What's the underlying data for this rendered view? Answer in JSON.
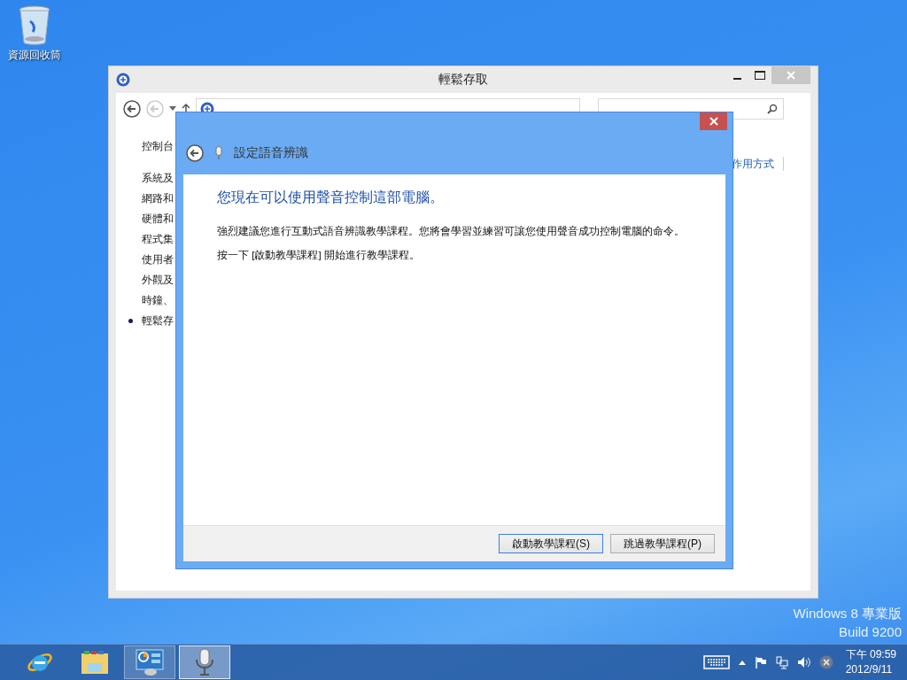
{
  "desktop": {
    "icons": [
      {
        "label": "資源回收筒"
      }
    ],
    "edition_lines": [
      "Windows 8 專業版",
      "Build 9200"
    ]
  },
  "control_panel_window": {
    "title": "輕鬆存取",
    "sidebar": {
      "heading": "控制台",
      "items": [
        {
          "label": "系統及",
          "selected": false
        },
        {
          "label": "網路和",
          "selected": false
        },
        {
          "label": "硬體和",
          "selected": false
        },
        {
          "label": "程式集",
          "selected": false
        },
        {
          "label": "使用者",
          "selected": false
        },
        {
          "label": "外觀及",
          "selected": false
        },
        {
          "label": "時鐘、",
          "selected": false
        },
        {
          "label": "輕鬆存",
          "selected": true
        }
      ]
    },
    "right_link": "作用方式"
  },
  "dialog": {
    "title": "設定語音辨識",
    "heading": "您現在可以使用聲音控制這部電腦。",
    "paragraphs": [
      "強烈建議您進行互動式語音辨識教學課程。您將會學習並練習可讓您使用聲音成功控制電腦的命令。",
      "按一下 [啟動教學課程] 開始進行教學課程。"
    ],
    "buttons": [
      {
        "label": "啟動教學課程(S)",
        "default": true
      },
      {
        "label": "跳過教學課程(P)",
        "default": false
      }
    ]
  },
  "taskbar": {
    "apps": [
      {
        "kind": "browser",
        "running": false,
        "selected": false
      },
      {
        "kind": "folder",
        "running": false,
        "selected": false
      },
      {
        "kind": "control-panel",
        "running": true,
        "selected": false
      },
      {
        "kind": "microphone",
        "running": true,
        "selected": true
      }
    ],
    "clock": {
      "time": "下午 09:59",
      "date": "2012/9/11"
    }
  }
}
